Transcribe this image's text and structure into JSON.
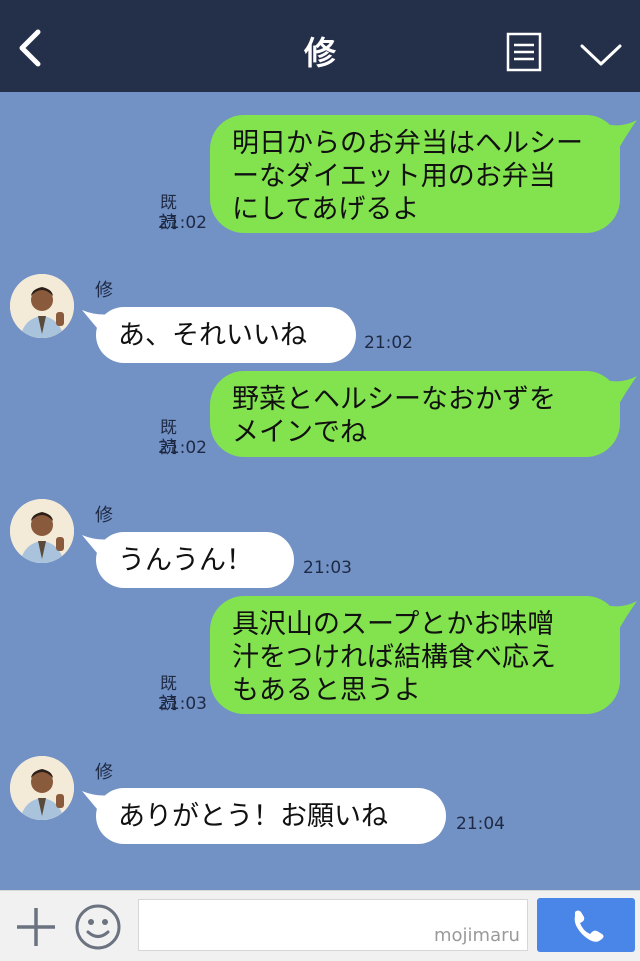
{
  "header": {
    "title": "修",
    "back_icon": "chevron-left-icon",
    "menu_icon": "list-icon",
    "collapse_icon": "chevron-down-icon"
  },
  "colors": {
    "header_bg": "#242f49",
    "chat_bg": "#7291c4",
    "outgoing_bubble": "#83e34e",
    "incoming_bubble": "#ffffff",
    "call_button": "#4a86e8"
  },
  "messages": [
    {
      "direction": "out",
      "text": "明日からのお弁当はヘルシー\nーなダイエット用のお弁当\nにしてあげるよ",
      "read": "既読",
      "time": "21:02"
    },
    {
      "direction": "in",
      "sender": "修",
      "text": "あ、それいいね",
      "time": "21:02"
    },
    {
      "direction": "out",
      "text": "野菜とヘルシーなおかずを\nメインでね",
      "read": "既読",
      "time": "21:02"
    },
    {
      "direction": "in",
      "sender": "修",
      "text": "うんうん！",
      "time": "21:03"
    },
    {
      "direction": "out",
      "text": "具沢山のスープとかお味噌\n汁をつければ結構食べ応え\nもあると思うよ",
      "read": "既読",
      "time": "21:03"
    },
    {
      "direction": "in",
      "sender": "修",
      "text": "ありがとう！お願いね",
      "time": "21:04"
    }
  ],
  "input_bar": {
    "plus_icon": "plus-icon",
    "emoji_icon": "smiley-icon",
    "input_value": "",
    "watermark": "mojimaru",
    "call_icon": "phone-icon"
  }
}
